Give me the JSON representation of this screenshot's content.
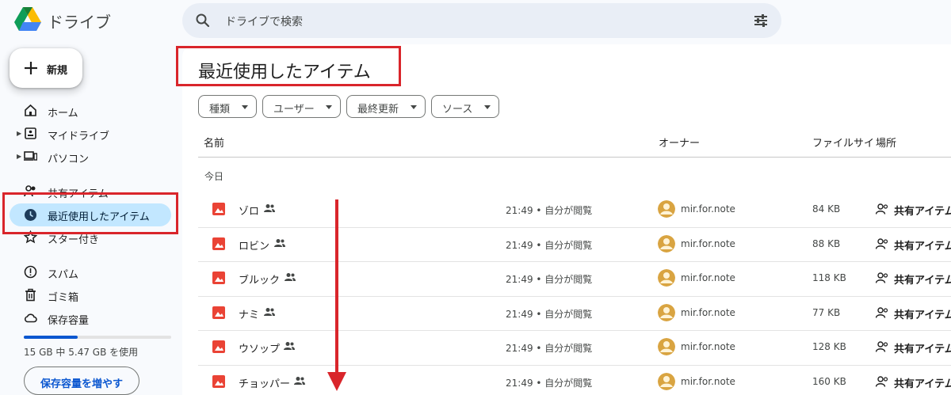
{
  "app": {
    "name": "ドライブ"
  },
  "search": {
    "placeholder": "ドライブで検索"
  },
  "sidebar": {
    "new_label": "新規",
    "items": [
      {
        "label": "ホーム",
        "icon": "home-icon"
      },
      {
        "label": "マイドライブ",
        "icon": "my-drive-icon"
      },
      {
        "label": "パソコン",
        "icon": "computers-icon"
      },
      {
        "label": "共有アイテム",
        "icon": "shared-icon"
      },
      {
        "label": "最近使用したアイテム",
        "icon": "clock-icon",
        "active": true
      },
      {
        "label": "スター付き",
        "icon": "star-icon"
      },
      {
        "label": "スパム",
        "icon": "spam-icon"
      },
      {
        "label": "ゴミ箱",
        "icon": "trash-icon"
      },
      {
        "label": "保存容量",
        "icon": "cloud-icon"
      }
    ],
    "storage": {
      "text": "15 GB 中 5.47 GB を使用",
      "used_fraction": 0.365,
      "button": "保存容量を増やす"
    }
  },
  "main": {
    "title": "最近使用したアイテム",
    "filters": [
      "種類",
      "ユーザー",
      "最終更新",
      "ソース"
    ],
    "columns": {
      "name": "名前",
      "owner": "オーナー",
      "size": "ファイルサイ",
      "location": "場所"
    },
    "group": "今日",
    "rows": [
      {
        "name": "ゾロ",
        "opened": "21:49 • 自分が閲覧",
        "owner": "mir.for.note",
        "size": "84 KB",
        "location": "共有アイテム"
      },
      {
        "name": "ロビン",
        "opened": "21:49 • 自分が閲覧",
        "owner": "mir.for.note",
        "size": "88 KB",
        "location": "共有アイテム"
      },
      {
        "name": "ブルック",
        "opened": "21:49 • 自分が閲覧",
        "owner": "mir.for.note",
        "size": "118 KB",
        "location": "共有アイテム"
      },
      {
        "name": "ナミ",
        "opened": "21:49 • 自分が閲覧",
        "owner": "mir.for.note",
        "size": "77 KB",
        "location": "共有アイテム"
      },
      {
        "name": "ウソップ",
        "opened": "21:49 • 自分が閲覧",
        "owner": "mir.for.note",
        "size": "128 KB",
        "location": "共有アイテム"
      },
      {
        "name": "チョッパー",
        "opened": "21:49 • 自分が閲覧",
        "owner": "mir.for.note",
        "size": "160 KB",
        "location": "共有アイテム"
      }
    ]
  },
  "colors": {
    "accent": "#0b57d0",
    "active_nav": "#c2e7ff",
    "highlight": "#d9252b",
    "image_icon": "#ea4335"
  }
}
